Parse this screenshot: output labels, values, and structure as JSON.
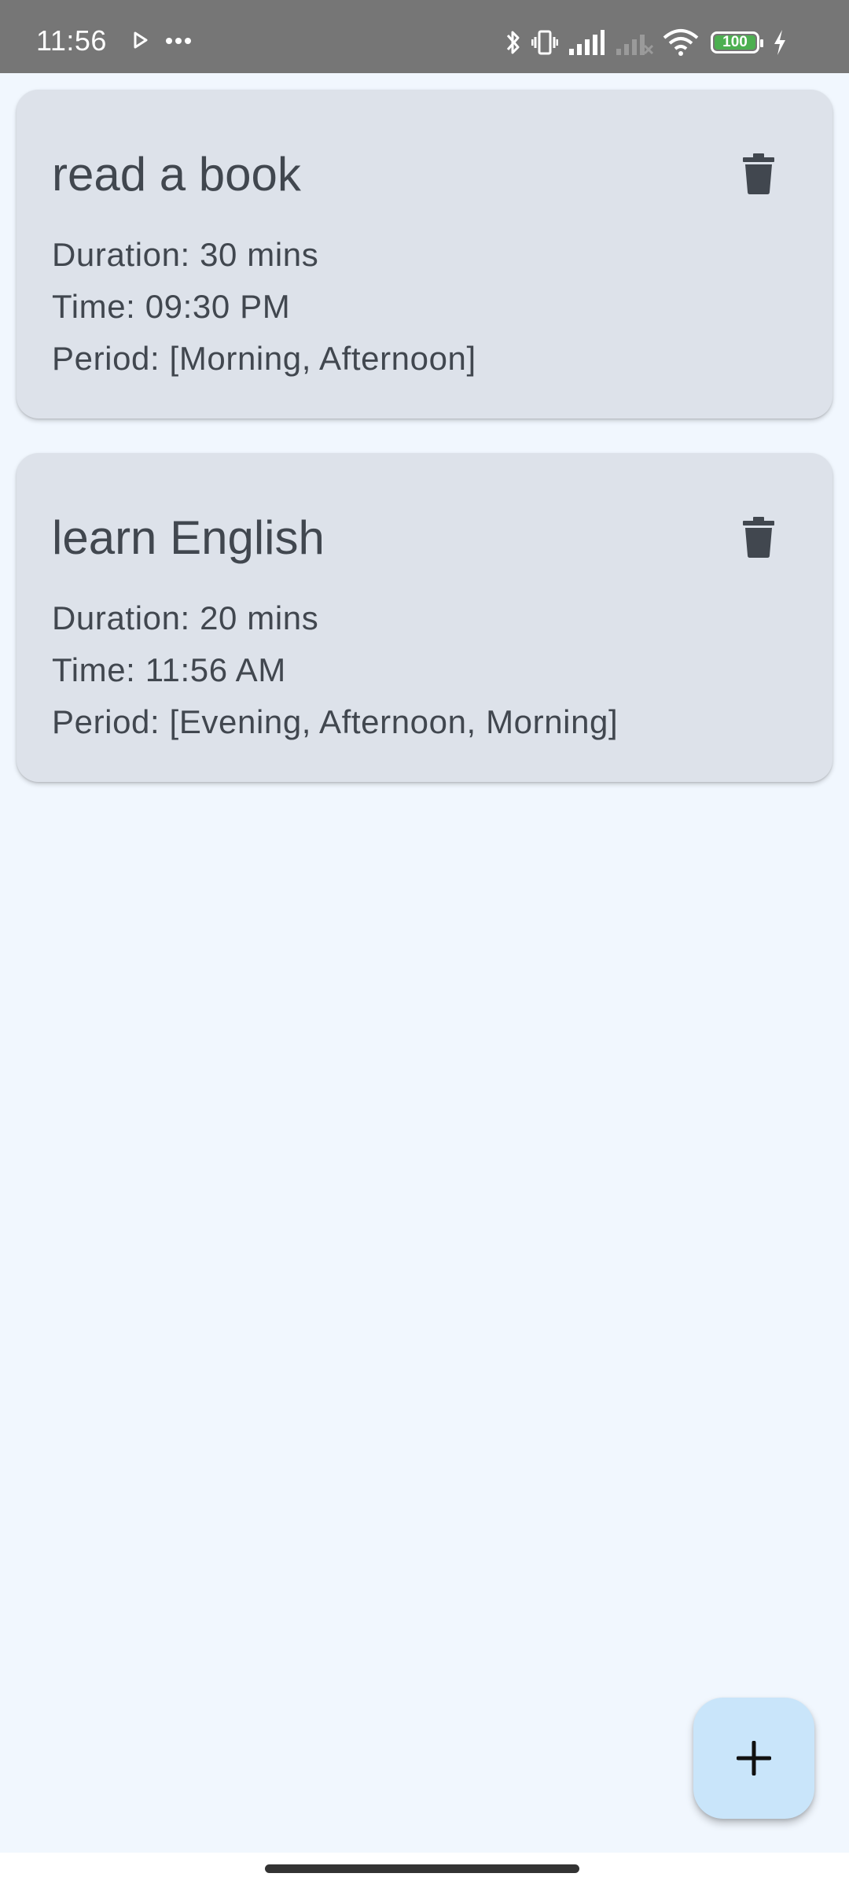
{
  "status_bar": {
    "time": "11:56",
    "battery_level": "100",
    "left_icons": [
      "play-icon",
      "more-icon"
    ],
    "right_icons": [
      "bluetooth-icon",
      "vibrate-icon",
      "signal-icon",
      "signal-no-service-icon",
      "wifi-icon",
      "battery-icon",
      "charging-icon"
    ],
    "battery_color": "#4caf50"
  },
  "tasks": [
    {
      "title": "read a book",
      "duration": "Duration: 30 mins",
      "time": "Time: 09:30 PM",
      "period": "Period: [Morning, Afternoon]"
    },
    {
      "title": "learn English",
      "duration": "Duration: 20 mins",
      "time": "Time: 11:56 AM",
      "period": "Period: [Evening, Afternoon, Morning]"
    }
  ],
  "fab": {
    "icon": "plus-icon"
  },
  "colors": {
    "background": "#f1f7fe",
    "card": "#dde2ea",
    "text": "#41474f",
    "fab": "#c9e5fa",
    "status_bar": "#767676"
  }
}
